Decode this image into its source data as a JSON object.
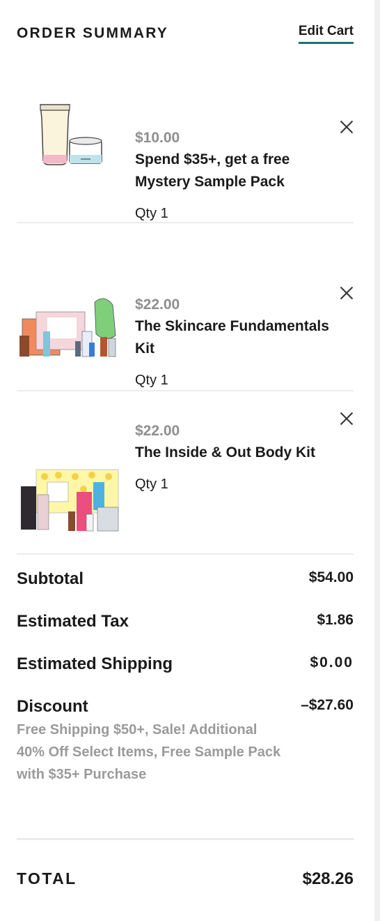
{
  "header": {
    "title": "ORDER SUMMARY",
    "edit_cart_label": "Edit Cart"
  },
  "items": [
    {
      "price": "$10.00",
      "name": "Spend $35+, get a free Mystery Sample Pack",
      "qty": "Qty 1"
    },
    {
      "price": "$22.00",
      "name": "The Skincare Fundamentals Kit",
      "qty": "Qty 1"
    },
    {
      "price": "$22.00",
      "name": "The Inside & Out Body Kit",
      "qty": "Qty 1"
    }
  ],
  "summary": {
    "subtotal_label": "Subtotal",
    "subtotal_value": "$54.00",
    "tax_label": "Estimated Tax",
    "tax_value": "$1.86",
    "shipping_label": "Estimated Shipping",
    "shipping_value": "$0.00",
    "discount_label": "Discount",
    "discount_value": "–$27.60",
    "discount_description": "Free Shipping $50+, Sale! Additional 40% Off Select Items, Free Sample Pack with $35+ Purchase"
  },
  "total": {
    "label": "TOTAL",
    "value": "$28.26"
  },
  "icons": {
    "remove": "close-icon"
  },
  "colors": {
    "accent": "#1f6f75",
    "muted_text": "#8e8e8e"
  }
}
